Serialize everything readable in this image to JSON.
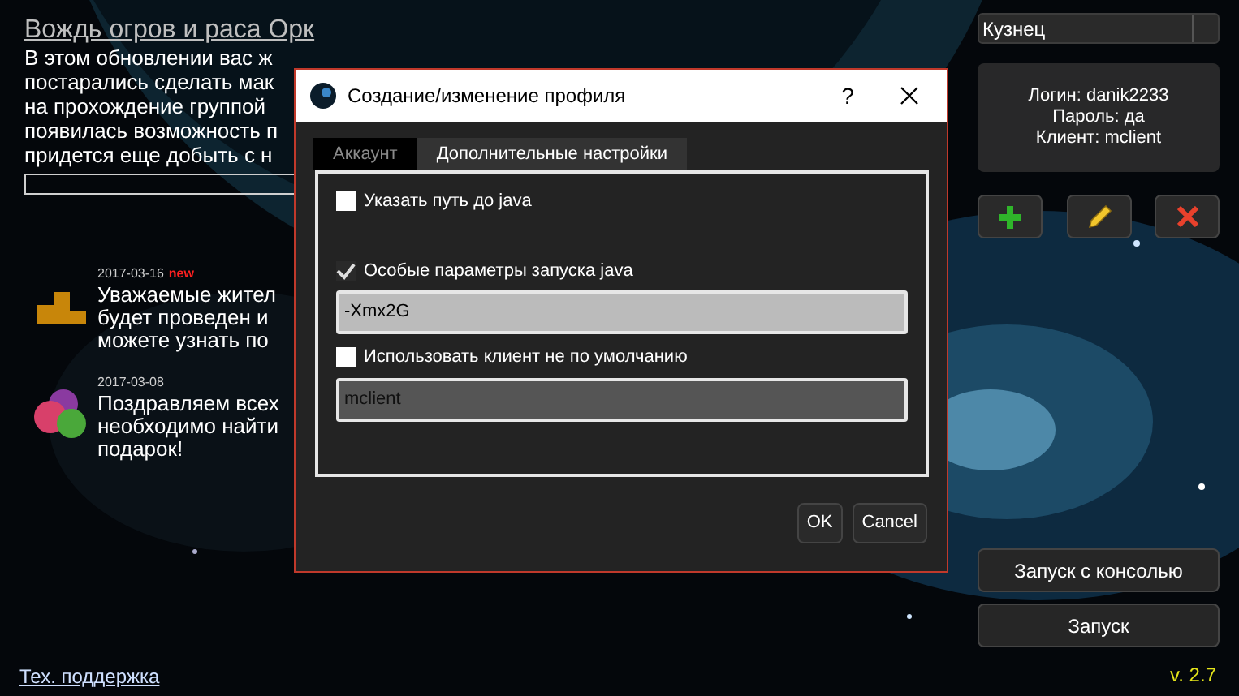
{
  "news": {
    "headline": "Вождь огров и раса Орк",
    "lines": [
      "В этом обновлении вас ж",
      "постарались сделать мак",
      "на прохождение группой",
      "появилась возможность п",
      "придется еще добыть с н"
    ],
    "items": [
      {
        "kind": "podium",
        "date": "2017-03-16",
        "badge": "new",
        "lines": [
          "Уважаемые жител",
          "будет проведен и",
          "можете узнать по"
        ]
      },
      {
        "kind": "balloons",
        "date": "2017-03-08",
        "lines": [
          "Поздравляем всех",
          "необходимо найти",
          "подарок!"
        ]
      }
    ]
  },
  "support_link": "Тех. поддержка",
  "profile_select": {
    "value": "Кузнец"
  },
  "profile_info": [
    "Логин: danik2233",
    "Пароль: да",
    "Клиент: mclient"
  ],
  "buttons": [
    "Запуск с консолью",
    "Запуск"
  ],
  "version": "v. 2.7",
  "dialog": {
    "title": "Создание/изменение профиля",
    "help": "?",
    "tabs": [
      {
        "label": "Аккаунт",
        "selected": false
      },
      {
        "label": "Дополнительные настройки",
        "selected": true
      }
    ],
    "options": [
      {
        "label": "Указать путь до java",
        "checked": false
      },
      {
        "label": "Особые параметры запуска java",
        "checked": true,
        "value": "-Xmx2G",
        "enabled": true
      },
      {
        "label": "Использовать клиент не по умолчанию",
        "checked": false,
        "value": "mclient",
        "enabled": false
      }
    ],
    "buttons": [
      "OK",
      "Cancel"
    ]
  }
}
